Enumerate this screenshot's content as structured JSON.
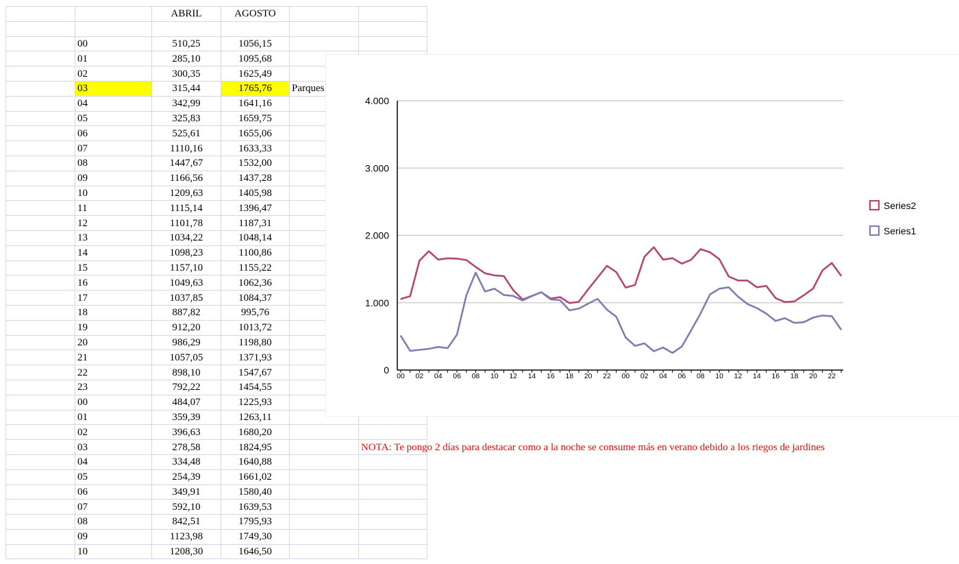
{
  "sheet": {
    "headers": [
      "",
      "",
      "ABRIL",
      "AGOSTO",
      "",
      ""
    ],
    "rows": [
      {
        "hour": "00",
        "abril": "510,25",
        "agosto": "1056,15"
      },
      {
        "hour": "01",
        "abril": "285,10",
        "agosto": "1095,68"
      },
      {
        "hour": "02",
        "abril": "300,35",
        "agosto": "1625,49"
      },
      {
        "hour": "03",
        "abril": "315,44",
        "agosto": "1765,76",
        "note": "Parques",
        "highlight": true
      },
      {
        "hour": "04",
        "abril": "342,99",
        "agosto": "1641,16"
      },
      {
        "hour": "05",
        "abril": "325,83",
        "agosto": "1659,75"
      },
      {
        "hour": "06",
        "abril": "525,61",
        "agosto": "1655,06"
      },
      {
        "hour": "07",
        "abril": "1110,16",
        "agosto": "1633,33"
      },
      {
        "hour": "08",
        "abril": "1447,67",
        "agosto": "1532,00"
      },
      {
        "hour": "09",
        "abril": "1166,56",
        "agosto": "1437,28"
      },
      {
        "hour": "10",
        "abril": "1209,63",
        "agosto": "1405,98"
      },
      {
        "hour": "11",
        "abril": "1115,14",
        "agosto": "1396,47"
      },
      {
        "hour": "12",
        "abril": "1101,78",
        "agosto": "1187,31"
      },
      {
        "hour": "13",
        "abril": "1034,22",
        "agosto": "1048,14"
      },
      {
        "hour": "14",
        "abril": "1098,23",
        "agosto": "1100,86"
      },
      {
        "hour": "15",
        "abril": "1157,10",
        "agosto": "1155,22"
      },
      {
        "hour": "16",
        "abril": "1049,63",
        "agosto": "1062,36"
      },
      {
        "hour": "17",
        "abril": "1037,85",
        "agosto": "1084,37"
      },
      {
        "hour": "18",
        "abril": "887,82",
        "agosto": "995,76"
      },
      {
        "hour": "19",
        "abril": "912,20",
        "agosto": "1013,72"
      },
      {
        "hour": "20",
        "abril": "986,29",
        "agosto": "1198,80"
      },
      {
        "hour": "21",
        "abril": "1057,05",
        "agosto": "1371,93"
      },
      {
        "hour": "22",
        "abril": "898,10",
        "agosto": "1547,67"
      },
      {
        "hour": "23",
        "abril": "792,22",
        "agosto": "1454,55"
      },
      {
        "hour": "00",
        "abril": "484,07",
        "agosto": "1225,93"
      },
      {
        "hour": "01",
        "abril": "359,39",
        "agosto": "1263,11"
      },
      {
        "hour": "02",
        "abril": "396,63",
        "agosto": "1680,20"
      },
      {
        "hour": "03",
        "abril": "278,58",
        "agosto": "1824,95"
      },
      {
        "hour": "04",
        "abril": "334,48",
        "agosto": "1640,88"
      },
      {
        "hour": "05",
        "abril": "254,39",
        "agosto": "1661,02"
      },
      {
        "hour": "06",
        "abril": "349,91",
        "agosto": "1580,40"
      },
      {
        "hour": "07",
        "abril": "592,10",
        "agosto": "1639,53"
      },
      {
        "hour": "08",
        "abril": "842,51",
        "agosto": "1795,93"
      },
      {
        "hour": "09",
        "abril": "1123,98",
        "agosto": "1749,30"
      },
      {
        "hour": "10",
        "abril": "1208,30",
        "agosto": "1646,50"
      }
    ]
  },
  "note": "NOTA: Te pongo 2 días para destacar como a la noche se consume más en verano debido a los riegos de jardines",
  "colors": {
    "series1": "#7b7fb0",
    "series2": "#b5466e",
    "highlight": "#ffff00",
    "note": "#ff0000",
    "grid": "#c4c4c4"
  },
  "chart_data": {
    "type": "line",
    "title": "",
    "xlabel": "",
    "ylabel": "",
    "ylim": [
      0,
      4000
    ],
    "y_ticks": [
      "0",
      "1.000",
      "2.000",
      "3.000",
      "4.000"
    ],
    "y_tick_values": [
      0,
      1000,
      2000,
      3000,
      4000
    ],
    "x": [
      "00",
      "01",
      "02",
      "03",
      "04",
      "05",
      "06",
      "07",
      "08",
      "09",
      "10",
      "11",
      "12",
      "13",
      "14",
      "15",
      "16",
      "17",
      "18",
      "19",
      "20",
      "21",
      "22",
      "23",
      "00",
      "01",
      "02",
      "03",
      "04",
      "05",
      "06",
      "07",
      "08",
      "09",
      "10",
      "11",
      "12",
      "13",
      "14",
      "15",
      "16",
      "17",
      "18",
      "19",
      "20",
      "21",
      "22",
      "23"
    ],
    "x_tick_labels": [
      "00",
      "02",
      "04",
      "06",
      "08",
      "10",
      "12",
      "14",
      "16",
      "18",
      "20",
      "22",
      "00",
      "02",
      "04",
      "06",
      "08",
      "10",
      "12",
      "14",
      "16",
      "18",
      "20",
      "22"
    ],
    "grid": true,
    "legend": "right",
    "series": [
      {
        "name": "Series2",
        "values": [
          1056.15,
          1095.68,
          1625.49,
          1765.76,
          1641.16,
          1659.75,
          1655.06,
          1633.33,
          1532.0,
          1437.28,
          1405.98,
          1396.47,
          1187.31,
          1048.14,
          1100.86,
          1155.22,
          1062.36,
          1084.37,
          995.76,
          1013.72,
          1198.8,
          1371.93,
          1547.67,
          1454.55,
          1225.93,
          1263.11,
          1680.2,
          1824.95,
          1640.88,
          1661.02,
          1580.4,
          1639.53,
          1795.93,
          1749.3,
          1646.5,
          1390,
          1330,
          1330,
          1230,
          1250,
          1070,
          1010,
          1020,
          1110,
          1210,
          1480,
          1590,
          1400
        ]
      },
      {
        "name": "Series1",
        "values": [
          510.25,
          285.1,
          300.35,
          315.44,
          342.99,
          325.83,
          525.61,
          1110.16,
          1447.67,
          1166.56,
          1209.63,
          1115.14,
          1101.78,
          1034.22,
          1098.23,
          1157.1,
          1049.63,
          1037.85,
          887.82,
          912.2,
          986.29,
          1057.05,
          898.1,
          792.22,
          484.07,
          359.39,
          396.63,
          278.58,
          334.48,
          254.39,
          349.91,
          592.1,
          842.51,
          1123.98,
          1208.3,
          1230,
          1090,
          980,
          920,
          840,
          730,
          770,
          700,
          710,
          780,
          810,
          800,
          600
        ]
      }
    ]
  }
}
